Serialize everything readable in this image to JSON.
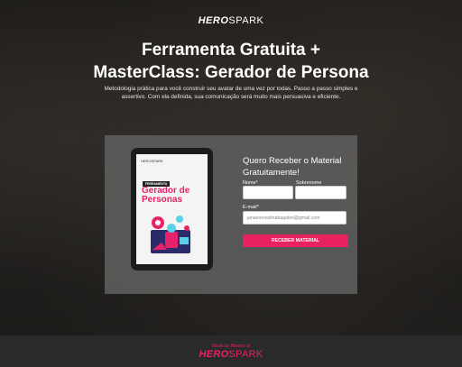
{
  "brand": {
    "bold": "HERO",
    "regular": "SPARK"
  },
  "header": {
    "headline_line1": "Ferramenta Gratuita +",
    "headline_line2": "MasterClass: Gerador de Persona",
    "description": "Metodologia prática para você construir seu avatar de uma vez por todas. Passo a passo simples e assertivo. Com ela definida, sua comunicação será muito mais persuasiva e eficiente."
  },
  "ebook": {
    "brand": "HEROSPARK",
    "tag": "FERRAMENTA",
    "title": "Gerador de Personas"
  },
  "form": {
    "title": "Quero Receber o Material Gratuitamente!",
    "name_label": "Nome*",
    "name_value": "",
    "surname_label": "Sobrenome",
    "surname_value": "",
    "email_label": "E-mail*",
    "email_placeholder": "janaineoristinabagatini@gmail.com",
    "submit_label": "RECEBER MATERIAL"
  },
  "footer": {
    "made_by": "Made by Heroes at",
    "logo_bold": "HERO",
    "logo_regular": "SPARK"
  },
  "colors": {
    "accent": "#e8225e",
    "panel": "#5f5f5f",
    "footer_bg": "#2a2a2a"
  }
}
